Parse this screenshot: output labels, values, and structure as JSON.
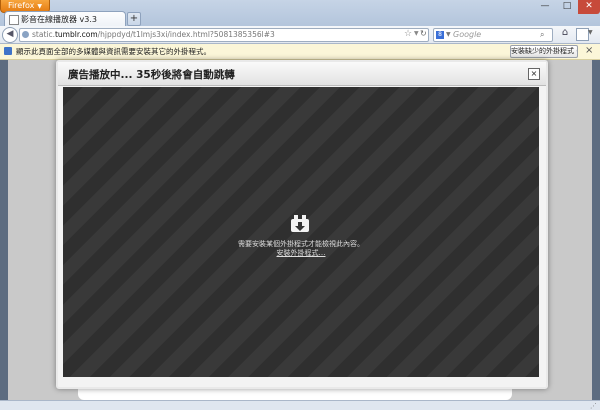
{
  "browser": {
    "menu_button": "Firefox",
    "tab_title": "影音在線播放器 v3.3",
    "new_tab": "+",
    "url_prefix": "static.",
    "url_domain": "tumblr.com",
    "url_path": "/hjppdyd/t1lmjs3xi/index.html?5081385356l#3",
    "search_engine_letter": "8",
    "search_placeholder": "Google"
  },
  "notification": {
    "message": "顯示此頁面全部的多媒體與資訊需要安裝其它的外掛程式。",
    "button_label": "安裝缺少的外掛程式 (I)…"
  },
  "dialog": {
    "title": "廣告播放中... 35秒後將會自動跳轉",
    "close": "×",
    "plugin_message": "需要安裝某個外掛程式才能檢視此內容。",
    "plugin_link": "安裝外掛程式…"
  },
  "colors": {
    "firefox_orange": "#e47b11",
    "notification_bg": "#fbf6d8",
    "video_bg": "#2f2f2f"
  }
}
